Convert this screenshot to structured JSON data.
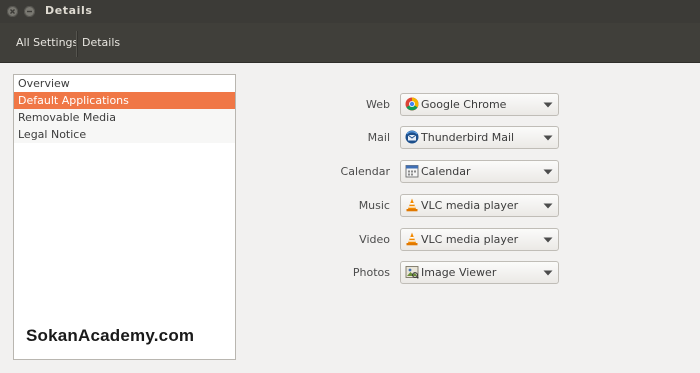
{
  "window": {
    "title": "Details"
  },
  "toolbar": {
    "all_settings": "All Settings",
    "details": "Details"
  },
  "sidebar": {
    "items": [
      {
        "label": "Overview",
        "selected": false
      },
      {
        "label": "Default Applications",
        "selected": true
      },
      {
        "label": "Removable Media",
        "selected": false
      },
      {
        "label": "Legal Notice",
        "selected": false
      }
    ]
  },
  "watermark": "SokanAcademy.com",
  "defaults": [
    {
      "label": "Web",
      "app": "Google Chrome",
      "icon": "chrome-icon"
    },
    {
      "label": "Mail",
      "app": "Thunderbird Mail",
      "icon": "thunderbird-icon"
    },
    {
      "label": "Calendar",
      "app": "Calendar",
      "icon": "calendar-icon"
    },
    {
      "label": "Music",
      "app": "VLC media player",
      "icon": "vlc-icon"
    },
    {
      "label": "Video",
      "app": "VLC media player",
      "icon": "vlc-icon"
    },
    {
      "label": "Photos",
      "app": "Image Viewer",
      "icon": "image-viewer-icon"
    }
  ],
  "colors": {
    "accent": "#f07746",
    "titlebar": "#3c3b37",
    "toolbar": "#403f3a"
  }
}
